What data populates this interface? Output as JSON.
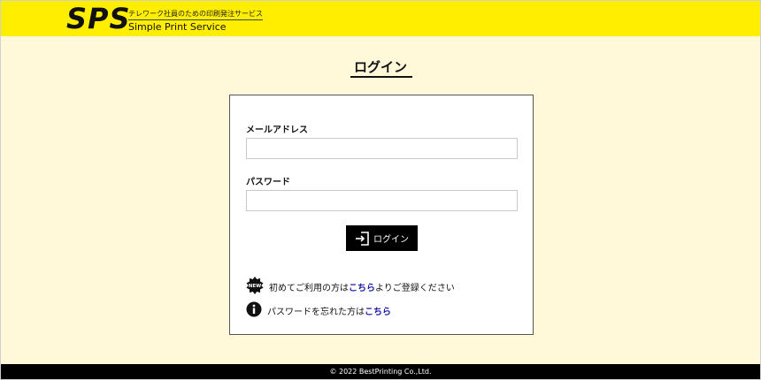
{
  "header": {
    "logo": "SPS",
    "tagline": "テレワーク社員のための印刷発注サービス",
    "brand_name": "Simple Print Service"
  },
  "page": {
    "title": "ログイン"
  },
  "form": {
    "email_label": "メールアドレス",
    "email_value": "",
    "password_label": "パスワード",
    "password_value": "",
    "login_button_label": "ログイン",
    "login_icon": "login-icon"
  },
  "links": {
    "new_user": {
      "icon": "new-badge-icon",
      "badge_text": "NEW",
      "prefix": "初めてご利用の方は",
      "link_text": "こちら",
      "suffix": "よりご登録ください"
    },
    "forgot_password": {
      "icon": "info-icon",
      "prefix": "パスワードを忘れた方は",
      "link_text": "こちら"
    }
  },
  "footer": {
    "copyright": "© 2022 BestPrinting Co.,Ltd."
  },
  "colors": {
    "header_bg": "#ffee00",
    "page_bg": "#fff8d9",
    "link": "#1a1aa6",
    "button_bg": "#000000"
  }
}
